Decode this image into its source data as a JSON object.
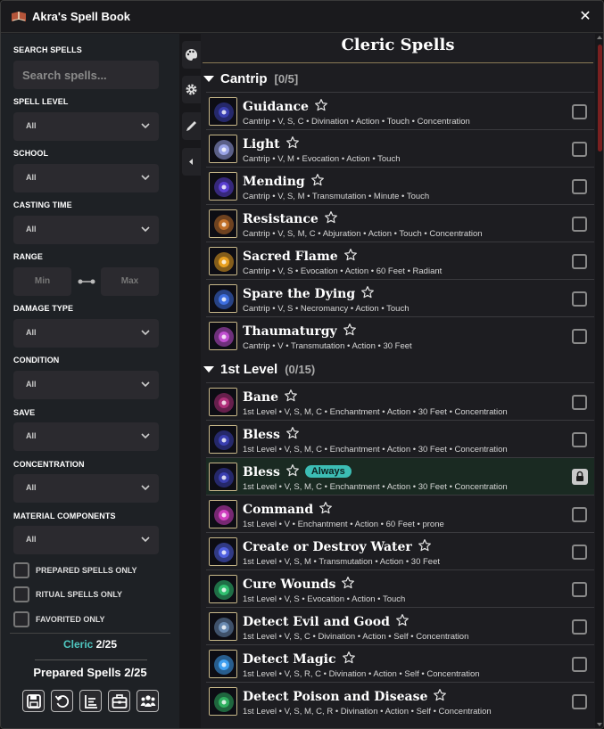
{
  "window": {
    "title": "Akra's Spell Book",
    "close_icon": "close-icon"
  },
  "sidebar": {
    "search_label": "SEARCH SPELLS",
    "search_placeholder": "Search spells...",
    "filters": [
      {
        "label": "SPELL LEVEL",
        "value": "All"
      },
      {
        "label": "SCHOOL",
        "value": "All"
      },
      {
        "label": "CASTING TIME",
        "value": "All"
      },
      {
        "label": "RANGE",
        "min_placeholder": "Min",
        "max_placeholder": "Max"
      },
      {
        "label": "DAMAGE TYPE",
        "value": "All"
      },
      {
        "label": "CONDITION",
        "value": "All"
      },
      {
        "label": "SAVE",
        "value": "All"
      },
      {
        "label": "CONCENTRATION",
        "value": "All"
      },
      {
        "label": "MATERIAL COMPONENTS",
        "value": "All"
      }
    ],
    "checkboxes": [
      "PREPARED SPELLS ONLY",
      "RITUAL SPELLS ONLY",
      "FAVORITED ONLY"
    ],
    "class_name": "Cleric",
    "class_count": "2/25",
    "prepared_label": "Prepared Spells",
    "prepared_count": "2/25",
    "tools": [
      "save-icon",
      "reset-icon",
      "list-icon",
      "toolbox-icon",
      "party-icon"
    ]
  },
  "tabs": [
    "palette-icon",
    "gear-icon",
    "pencil-icon",
    "collapse-icon"
  ],
  "main": {
    "title": "Cleric Spells",
    "sections": [
      {
        "name": "Cantrip",
        "count": "[0/5]",
        "spells": [
          {
            "name": "Guidance",
            "meta": "Cantrip • V, S, C • Divination • Action • Touch • Concentration",
            "icon": "#3a3fb0"
          },
          {
            "name": "Light",
            "meta": "Cantrip • V, M • Evocation • Action • Touch",
            "icon": "#9aa4e6"
          },
          {
            "name": "Mending",
            "meta": "Cantrip • V, S, M • Transmutation • Minute • Touch",
            "icon": "#5a3fd0"
          },
          {
            "name": "Resistance",
            "meta": "Cantrip • V, S, M, C • Abjuration • Action • Touch • Concentration",
            "icon": "#c0702a"
          },
          {
            "name": "Sacred Flame",
            "meta": "Cantrip • V, S • Evocation • Action • 60 Feet • Radiant",
            "icon": "#e8a020"
          },
          {
            "name": "Spare the Dying",
            "meta": "Cantrip • V, S • Necromancy • Action • Touch",
            "icon": "#3e6fe0"
          },
          {
            "name": "Thaumaturgy",
            "meta": "Cantrip • V • Transmutation • Action • 30 Feet",
            "icon": "#c04fd0"
          }
        ]
      },
      {
        "name": "1st Level",
        "count": "(0/15)",
        "spells": [
          {
            "name": "Bane",
            "meta": "1st Level • V, S, M, C • Enchantment • Action • 30 Feet • Concentration",
            "icon": "#b0307a"
          },
          {
            "name": "Bless",
            "meta": "1st Level • V, S, M, C • Enchantment • Action • 30 Feet • Concentration",
            "icon": "#3a3fb0"
          },
          {
            "name": "Bless",
            "meta": "1st Level • V, S, M, C • Enchantment • Action • 30 Feet • Concentration",
            "icon": "#3a3fb0",
            "badge": "Always",
            "locked": true
          },
          {
            "name": "Command",
            "meta": "1st Level • V • Enchantment • Action • 60 Feet • prone",
            "icon": "#d040c0"
          },
          {
            "name": "Create or Destroy Water",
            "meta": "1st Level • V, S, M • Transmutation • Action • 30 Feet",
            "icon": "#5060e0"
          },
          {
            "name": "Cure Wounds",
            "meta": "1st Level • V, S • Evocation • Action • Touch",
            "icon": "#30c070"
          },
          {
            "name": "Detect Evil and Good",
            "meta": "1st Level • V, S, C • Divination • Action • Self • Concentration",
            "icon": "#6a8ab0"
          },
          {
            "name": "Detect Magic",
            "meta": "1st Level • V, S, R, C • Divination • Action • Self • Concentration",
            "icon": "#40a0f0"
          },
          {
            "name": "Detect Poison and Disease",
            "meta": "1st Level • V, S, M, C, R • Divination • Action • Self • Concentration",
            "icon": "#30b060"
          }
        ]
      }
    ]
  }
}
